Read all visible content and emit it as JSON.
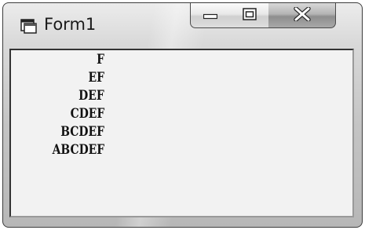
{
  "window": {
    "title": "Form1",
    "icon": "form-icon",
    "controls": {
      "minimize_icon": "minimize-icon",
      "maximize_icon": "maximize-icon",
      "close_icon": "close-icon",
      "close_label": "X"
    }
  },
  "client": {
    "lines": [
      "F",
      "EF",
      "DEF",
      "CDEF",
      "BCDEF",
      "ABCDEF"
    ]
  }
}
